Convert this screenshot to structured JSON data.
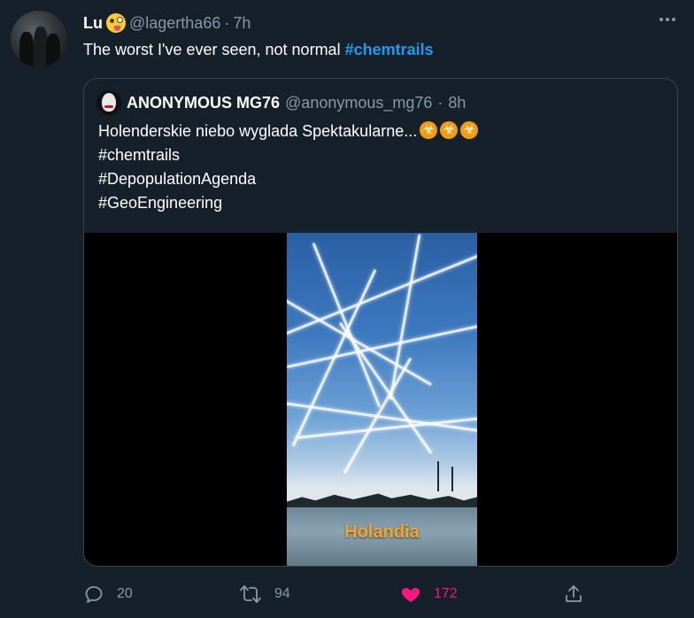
{
  "tweet": {
    "author_name": "Lu",
    "handle": "@lagertha66",
    "time": "7h",
    "text": "The worst I've ever seen, not normal ",
    "hashtag": "#chemtrails"
  },
  "quote": {
    "author_name": "ANONYMOUS MG76",
    "handle": "@anonymous_mg76",
    "time": "8h",
    "lines": [
      "Holenderskie niebo wyglada Spektakularne...",
      "#chemtrails",
      "#DepopulationAgenda",
      "#GeoEngineering"
    ],
    "media_label": "Holandia"
  },
  "actions": {
    "replies": "20",
    "retweets": "94",
    "likes": "172"
  },
  "colors": {
    "background": "#15202b",
    "link": "#1d9bf0",
    "muted": "#8899a6",
    "like": "#f91880",
    "label": "#f5a623"
  },
  "icons": [
    "more-icon",
    "reply-icon",
    "retweet-icon",
    "heart-icon",
    "share-icon",
    "biohazard-icon",
    "winking-tongue-emoji-icon"
  ]
}
